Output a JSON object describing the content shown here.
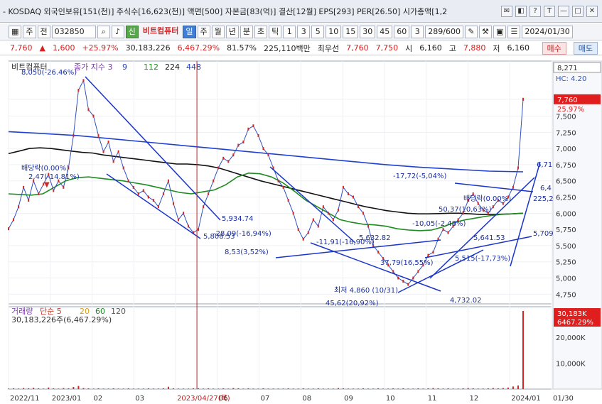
{
  "window": {
    "title": "- KOSDAQ 외국인보유[151(천)] 주식수[16,623(천)] 액면[500] 자본금[83(억)] 결산[12월] EPS[293] PER[26.50] 시가총액[1,2",
    "buttons": [
      "✉",
      "◧",
      "?",
      "T",
      "—",
      "□",
      "✕"
    ]
  },
  "toolbar": {
    "type_label": "주",
    "prev_label": "전",
    "code": "032850",
    "stock_name": "비트컴퓨터",
    "periods": [
      "일",
      "주",
      "월",
      "년",
      "분",
      "초",
      "틱"
    ],
    "active_period": "일",
    "intervals": [
      "1",
      "3",
      "5",
      "10",
      "15",
      "30",
      "45",
      "60"
    ],
    "selected_interval": "3",
    "count": "289/600",
    "date": "2024/01/30"
  },
  "quote": {
    "price": "7,760",
    "change": "1,600",
    "change_pct": "+25.97%",
    "volume": "30,183,226",
    "volume_pct": "6,467.29%",
    "ratio": "81.57%",
    "amount": "225,110백만",
    "best_ask_label": "최우선",
    "ask": "7,760",
    "bid": "7,750",
    "open_label": "시",
    "open": "6,160",
    "high_label": "고",
    "high": "7,880",
    "low_label": "저",
    "low": "6,160",
    "buy_label": "매수",
    "sell_label": "매도"
  },
  "chart_data": {
    "type": "line",
    "legend": {
      "name": "비트컴퓨터",
      "ma_label": "종가 지수 3",
      "ma_periods": [
        "9",
        "112",
        "224",
        "448"
      ]
    },
    "x_ticks": [
      "2022/11",
      "2023/01",
      "02",
      "03",
      "2023/04/27(목)",
      "06",
      "07",
      "08",
      "09",
      "10",
      "11",
      "12",
      "2024/01",
      "01/30"
    ],
    "y_ticks": [
      "4,750",
      "5,000",
      "5,250",
      "5,500",
      "5,750",
      "6,000",
      "6,250",
      "6,500",
      "6,750",
      "7,000",
      "7,250",
      "7,500",
      "7,760"
    ],
    "ylim": [
      4600,
      8350
    ],
    "price_box": "8,271",
    "hc_label": "HC: 4.20",
    "current_price": "7,760",
    "current_pct": "25.97%",
    "annotations": [
      "8,050(-26.46%)",
      "배당락(0.00%)",
      "2,47(-14.81%)",
      "5,934.74",
      "5,808.53",
      "-28,09(-16,94%)",
      "8,53(3,52%)",
      "-11,91(-16,90%)",
      "5,632.82",
      "37,79(16,55%)",
      "최저 4,860 (10/31)",
      "45,62(20,92%)",
      "4,732.02",
      "-10,05(-2,48%)",
      "5,641.53",
      "50,37(10,63%)",
      "배당락(0.00%)",
      "-17,72(-5,04%)",
      "6,71",
      "6,4",
      "225,2",
      "5,709",
      "5,515(-17,73%)"
    ],
    "close": [
      5760,
      5900,
      6100,
      6400,
      6200,
      6500,
      6300,
      6450,
      6600,
      6350,
      6500,
      6400,
      6700,
      7200,
      7900,
      8050,
      7600,
      7500,
      7200,
      6950,
      7100,
      6800,
      6950,
      6700,
      6500,
      6400,
      6300,
      6350,
      6250,
      6200,
      6100,
      6300,
      6500,
      6150,
      5900,
      6000,
      5800,
      5700,
      5750,
      6100,
      6300,
      6500,
      6700,
      6850,
      6800,
      6900,
      7050,
      7100,
      7300,
      7350,
      7200,
      7000,
      6900,
      6700,
      6500,
      6400,
      6200,
      6000,
      5750,
      5600,
      5700,
      5900,
      5800,
      6100,
      6000,
      5900,
      6050,
      6400,
      6300,
      6250,
      6100,
      6000,
      5800,
      5500,
      5400,
      5300,
      5200,
      5100,
      5000,
      4950,
      4900,
      5000,
      5100,
      5200,
      5350,
      5400,
      5600,
      5750,
      5700,
      5800,
      5900,
      6000,
      6200,
      6300,
      6150,
      6050,
      6000,
      6100,
      6200,
      6150,
      6250,
      6400,
      6700,
      7760
    ],
    "sma_long": [
      6920,
      6960,
      7000,
      7010,
      7000,
      6980,
      6960,
      6940,
      6930,
      6900,
      6880,
      6860,
      6840,
      6820,
      6800,
      6780,
      6760,
      6760,
      6750,
      6730,
      6700,
      6650,
      6600,
      6550,
      6500,
      6460,
      6420,
      6380,
      6340,
      6300,
      6260,
      6220,
      6180,
      6140,
      6100,
      6070,
      6040,
      6020,
      6000,
      5990,
      5990,
      5995,
      6000,
      6000,
      5990,
      5980,
      5980,
      5985,
      5990,
      6000
    ],
    "sma_mid": [
      6300,
      6290,
      6280,
      6300,
      6400,
      6500,
      6550,
      6560,
      6540,
      6520,
      6500,
      6470,
      6440,
      6400,
      6360,
      6320,
      6300,
      6330,
      6360,
      6440,
      6560,
      6620,
      6610,
      6560,
      6470,
      6340,
      6200,
      6100,
      6000,
      5900,
      5860,
      5830,
      5820,
      5800,
      5760,
      5740,
      5730,
      5740,
      5790,
      5860,
      5900,
      5930,
      5960,
      5980,
      5990,
      6000
    ],
    "sma_upper": [
      7260,
      7230,
      7200,
      7150,
      7100,
      7050,
      7000,
      6950,
      6900,
      6850,
      6800,
      6750,
      6710,
      6680,
      6650,
      6640
    ],
    "volume": [
      2,
      3,
      2,
      4,
      3,
      5,
      3,
      2,
      6,
      3,
      2,
      4,
      3,
      8,
      12,
      4,
      3,
      2,
      3,
      2,
      2,
      3,
      2,
      2,
      3,
      2,
      2,
      2,
      3,
      2,
      2,
      3,
      9,
      3,
      2,
      2,
      2,
      3,
      3,
      2,
      3,
      2,
      2,
      3,
      2,
      4,
      3,
      2,
      3,
      2,
      2,
      3,
      2,
      2,
      2,
      2,
      3,
      2,
      2,
      3,
      2,
      2,
      3,
      2,
      2,
      2,
      4,
      3,
      2,
      2,
      2,
      3,
      2,
      2,
      3,
      2,
      2,
      3,
      2,
      3,
      2,
      2,
      3,
      2,
      3,
      4,
      3,
      2,
      3,
      2,
      2,
      3,
      4,
      3,
      2,
      2,
      3,
      4,
      3,
      4,
      6,
      10,
      14,
      301
    ],
    "volume_ticks": [
      "10,000K",
      "20,000K"
    ],
    "volume_legend": "거래량",
    "volume_ma_label": "단순 5",
    "volume_ma_periods": [
      "20",
      "60",
      "120"
    ],
    "volume_current": "30,183,226주(6,467.29%)",
    "volume_box": "30,183K",
    "volume_box_pct": "6467.29%"
  }
}
